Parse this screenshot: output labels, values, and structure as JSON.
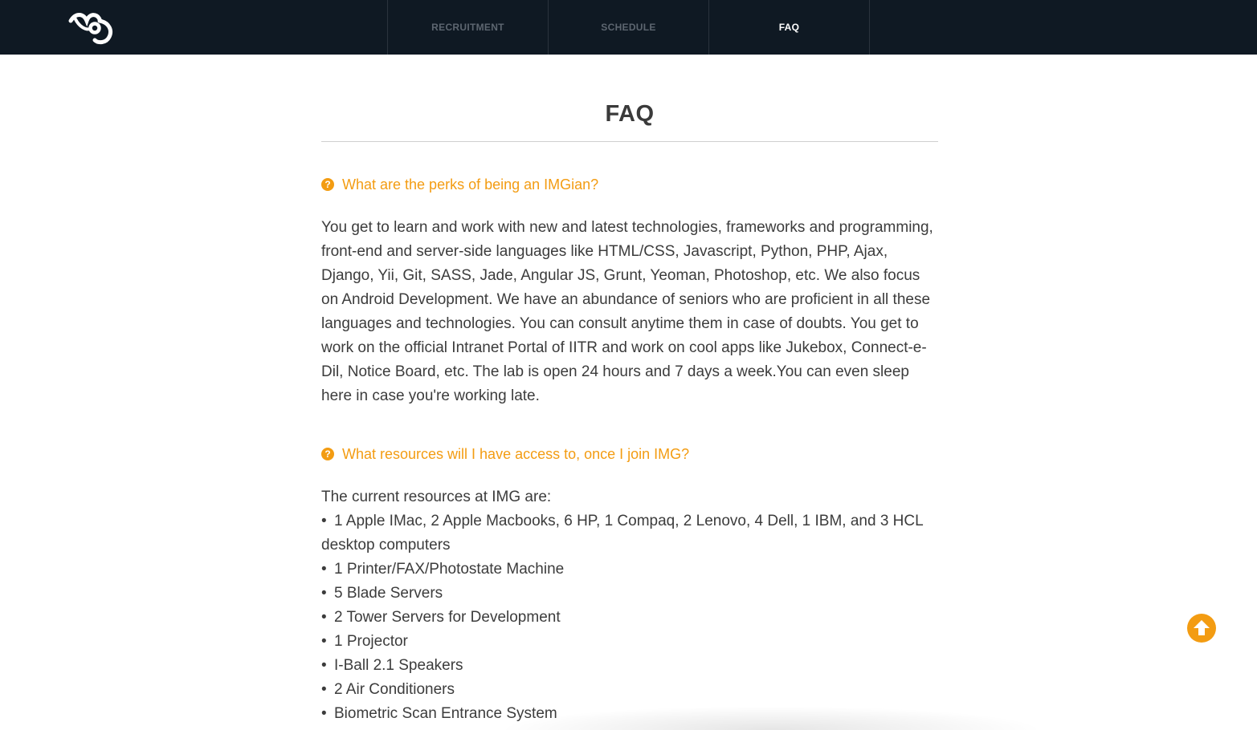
{
  "header": {
    "logo_icon": "img-logo-icon",
    "nav": [
      {
        "label": "RECRUITMENT",
        "active": false
      },
      {
        "label": "SCHEDULE",
        "active": false
      },
      {
        "label": "FAQ",
        "active": true
      }
    ]
  },
  "main": {
    "title": "FAQ",
    "faqs": [
      {
        "icon": "question-circle-icon",
        "question": "What are the perks of being an IMGian?",
        "answer": "You get to learn and work with new and latest technologies, frameworks and programming, front-end and server-side languages like HTML/CSS, Javascript, Python, PHP, Ajax, Django, Yii, Git, SASS, Jade, Angular JS, Grunt, Yeoman, Photoshop, etc. We also focus on Android Development. We have an abundance of seniors who are proficient in all these languages and technologies. You can consult anytime them in case of doubts. You get to work on the official Intranet Portal of IITR and work on cool apps like Jukebox, Connect-e-Dil, Notice Board, etc. The lab is open 24 hours and 7 days a week.You can even sleep here in case you're working late."
      },
      {
        "icon": "question-circle-icon",
        "question": "What resources will I have access to, once I join IMG?",
        "intro": "The current resources at IMG are:",
        "items": [
          "1 Apple IMac, 2 Apple Macbooks, 6 HP, 1 Compaq, 2 Lenovo, 4 Dell, 1 IBM, and 3 HCL desktop computers",
          "1 Printer/FAX/Photostate Machine",
          "5 Blade Servers",
          "2 Tower Servers for Development",
          "1 Projector",
          "I-Ball 2.1 Speakers",
          "2 Air Conditioners",
          "Biometric Scan Entrance System"
        ]
      }
    ]
  },
  "scroll_top": {
    "icon": "arrow-up-circle-icon"
  },
  "colors": {
    "header_bg": "#0f1923",
    "accent": "#f39c12",
    "nav_inactive": "#5d6670",
    "nav_active": "#ffffff"
  }
}
